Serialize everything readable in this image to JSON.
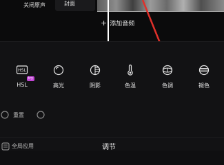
{
  "top_bar": {
    "close_sound_label": "关闭原声",
    "cover_label": "封面",
    "add_audio_label": "添加音频"
  },
  "tools": [
    {
      "label": "HSL",
      "badge": "try",
      "icon": "hsl-icon"
    },
    {
      "label": "高光",
      "icon": "highlight-icon"
    },
    {
      "label": "阴影",
      "icon": "shadow-icon"
    },
    {
      "label": "色温",
      "icon": "thermometer-icon"
    },
    {
      "label": "色调",
      "icon": "tone-icon"
    },
    {
      "label": "褪色",
      "icon": "fade-icon"
    }
  ],
  "reset_label": "重置",
  "global_apply_label": "全局应用",
  "panel_title": "调节",
  "colors": {
    "background": "#121214",
    "pointer_arrow": "#e0302a",
    "badge": "#c245d6"
  }
}
